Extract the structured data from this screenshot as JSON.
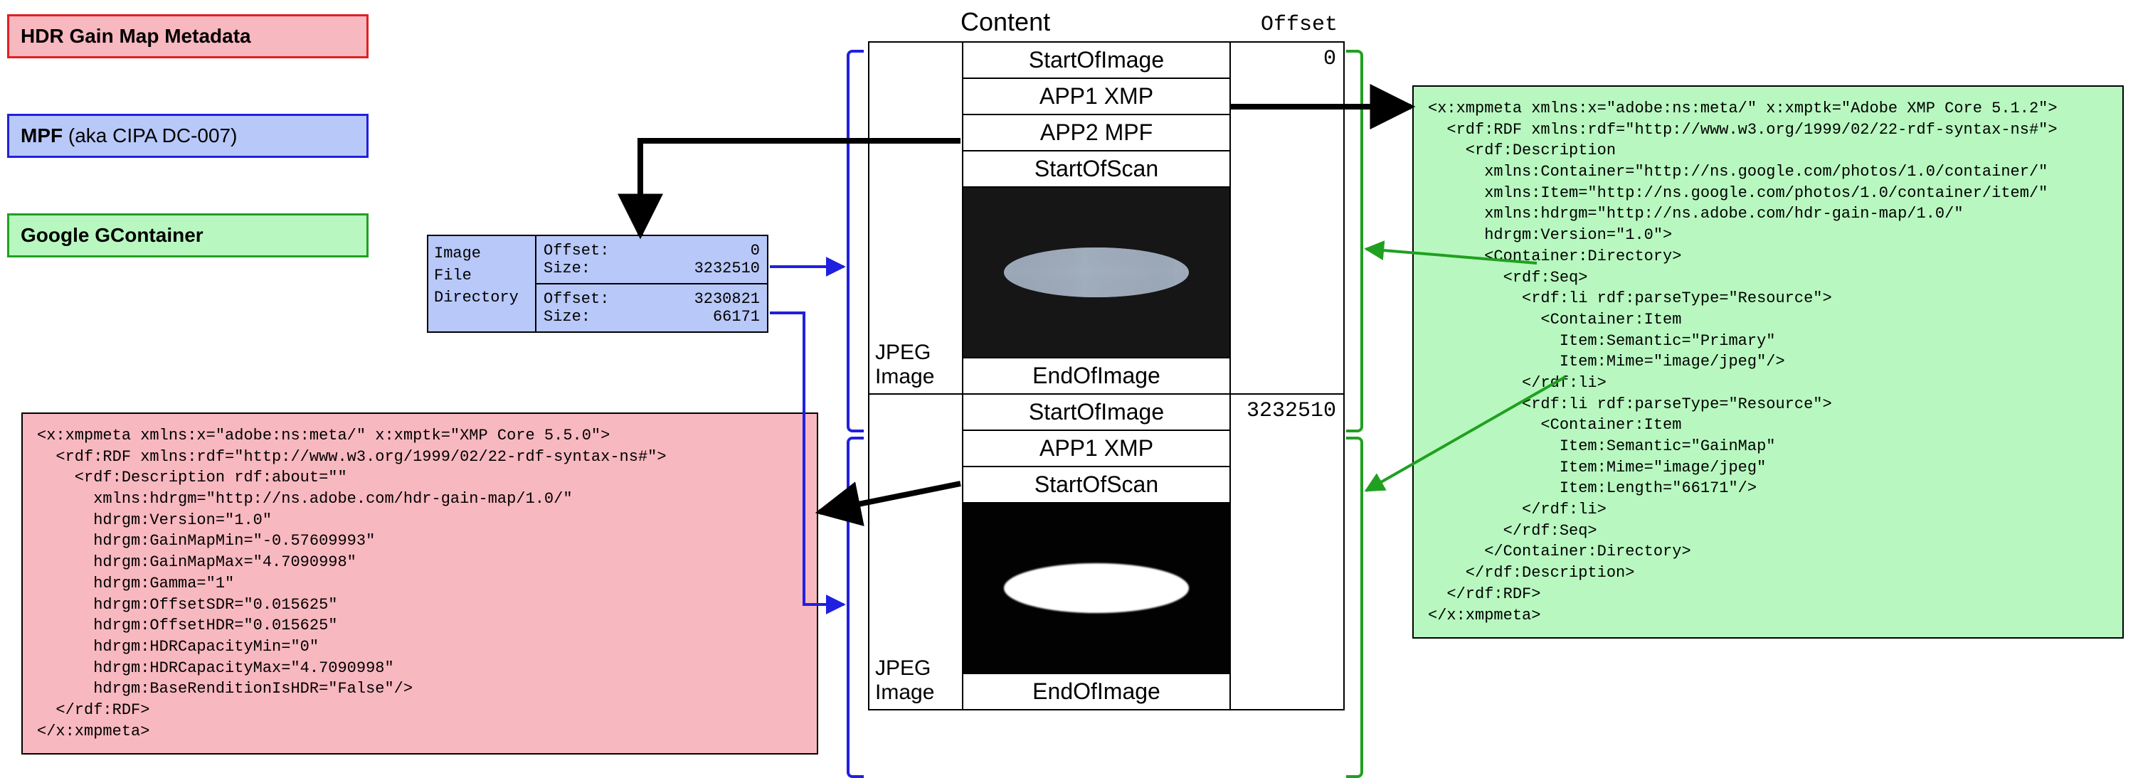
{
  "legend": {
    "hdr": "HDR Gain Map Metadata",
    "mpf_bold": "MPF",
    "mpf_rest": " (aka CIPA DC-007)",
    "gcontainer": "Google GContainer"
  },
  "headers": {
    "content": "Content",
    "offset": "Offset"
  },
  "jpeg_label": "JPEG\nImage",
  "segments1": [
    "StartOfImage",
    "APP1 XMP",
    "APP2 MPF",
    "StartOfScan",
    "__IMG_DARK__",
    "EndOfImage"
  ],
  "segments2": [
    "StartOfImage",
    "APP1 XMP",
    "StartOfScan",
    "__IMG_BW__",
    "EndOfImage"
  ],
  "offsets": {
    "first": "0",
    "second": "3232510"
  },
  "ifd": {
    "label": "Image\nFile\nDirectory",
    "rows": [
      {
        "offset_k": "Offset:",
        "offset_v": "0",
        "size_k": "Size:",
        "size_v": "3232510"
      },
      {
        "offset_k": "Offset:",
        "offset_v": "3230821",
        "size_k": "Size:",
        "size_v": "66171"
      }
    ]
  },
  "xmp_hdr": "<x:xmpmeta xmlns:x=\"adobe:ns:meta/\" x:xmptk=\"XMP Core 5.5.0\">\n  <rdf:RDF xmlns:rdf=\"http://www.w3.org/1999/02/22-rdf-syntax-ns#\">\n    <rdf:Description rdf:about=\"\"\n      xmlns:hdrgm=\"http://ns.adobe.com/hdr-gain-map/1.0/\"\n      hdrgm:Version=\"1.0\"\n      hdrgm:GainMapMin=\"-0.57609993\"\n      hdrgm:GainMapMax=\"4.7090998\"\n      hdrgm:Gamma=\"1\"\n      hdrgm:OffsetSDR=\"0.015625\"\n      hdrgm:OffsetHDR=\"0.015625\"\n      hdrgm:HDRCapacityMin=\"0\"\n      hdrgm:HDRCapacityMax=\"4.7090998\"\n      hdrgm:BaseRenditionIsHDR=\"False\"/>\n  </rdf:RDF>\n</x:xmpmeta>",
  "xmp_container": "<x:xmpmeta xmlns:x=\"adobe:ns:meta/\" x:xmptk=\"Adobe XMP Core 5.1.2\">\n  <rdf:RDF xmlns:rdf=\"http://www.w3.org/1999/02/22-rdf-syntax-ns#\">\n    <rdf:Description\n      xmlns:Container=\"http://ns.google.com/photos/1.0/container/\"\n      xmlns:Item=\"http://ns.google.com/photos/1.0/container/item/\"\n      xmlns:hdrgm=\"http://ns.adobe.com/hdr-gain-map/1.0/\"\n      hdrgm:Version=\"1.0\">\n      <Container:Directory>\n        <rdf:Seq>\n          <rdf:li rdf:parseType=\"Resource\">\n            <Container:Item\n              Item:Semantic=\"Primary\"\n              Item:Mime=\"image/jpeg\"/>\n          </rdf:li>\n          <rdf:li rdf:parseType=\"Resource\">\n            <Container:Item\n              Item:Semantic=\"GainMap\"\n              Item:Mime=\"image/jpeg\"\n              Item:Length=\"66171\"/>\n          </rdf:li>\n        </rdf:Seq>\n      </Container:Directory>\n    </rdf:Description>\n  </rdf:RDF>\n</x:xmpmeta>"
}
